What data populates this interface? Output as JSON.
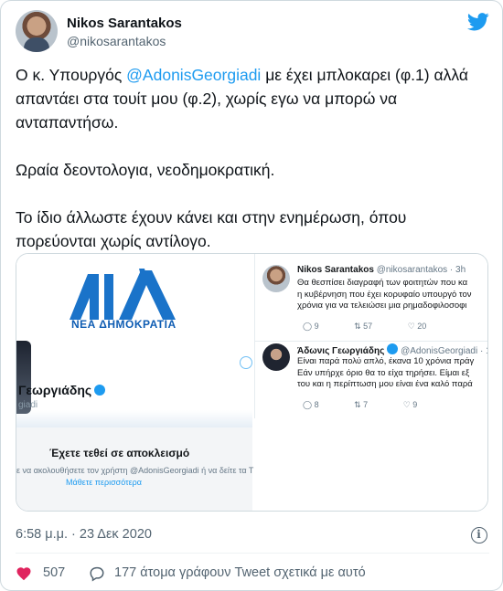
{
  "author": {
    "name": "Nikos Sarantakos",
    "handle": "@nikosarantakos"
  },
  "tweet": {
    "line1_before": "Ο κ. Υπουργός ",
    "mention": "@AdonisGeorgiadi",
    "line1_after": " με έχει μπλοκαρει (φ.1) αλλά απαντάει στα τουίτ μου (φ.2), χωρίς εγω να μπορώ να ανταπαντήσω.",
    "para2": "Ωραία δεοντολογια, νεοδημοκρατική.",
    "para3": "Το ίδιο άλλωστε έχουν κάνει και στην ενημέρωση, όπου πορεύονται χωρίς αντίλογο."
  },
  "media": {
    "left": {
      "logo_text": "ΝΕΑ ΔΗΜΟΚΡΑΤΙΑ",
      "profile_name": "Γεωργιάδης",
      "profile_handle": "giadi",
      "blocked_title": "Έχετε τεθεί σε αποκλεισμό",
      "blocked_sub": "ε να ακολουθήσετε τον χρήστη @AdonisGeorgiadi ή να δείτε τα Τ",
      "blocked_link": "Μάθετε περισσότερα"
    },
    "right": {
      "tweet1": {
        "name": "Nikos Sarantakos",
        "meta": "@nikosarantakos · 3h",
        "lines": [
          "Θα θεσπίσει διαγραφή των φοιτητών που κα",
          "η κυβέρνηση που έχει κορυφαίο υπουργό τον",
          "χρόνια για να τελειώσει μια ρημαδοφιλοσοφι"
        ],
        "replies": "9",
        "retweets": "57",
        "likes": "20"
      },
      "tweet2": {
        "name": "Άδωνις Γεωργιάδης",
        "meta": "@AdonisGeorgiadi · 1",
        "lines": [
          "Είναι παρά πολύ απλό, έκανα 10 χρόνια πράγ",
          "Εάν υπήρχε όριο θα το είχα τηρήσει. Είμαι εξ",
          "του και η περίπτωση μου είναι ένα καλό παρά"
        ],
        "replies": "8",
        "retweets": "7",
        "likes": "9"
      }
    }
  },
  "timestamp": "6:58 μ.μ. · 23 Δεκ 2020",
  "actions": {
    "likes": "507",
    "reply_text": "177 άτομα γράφουν Tweet σχετικά με αυτό"
  },
  "colors": {
    "accent": "#1d9bf0",
    "nd_blue": "#0f5db3",
    "secondary_text": "#536471",
    "like_red": "#e0245e"
  },
  "icons": [
    "twitter-bird-icon",
    "verified-badge-icon",
    "info-icon",
    "heart-icon",
    "reply-bubble-icon",
    "retweet-icon"
  ]
}
